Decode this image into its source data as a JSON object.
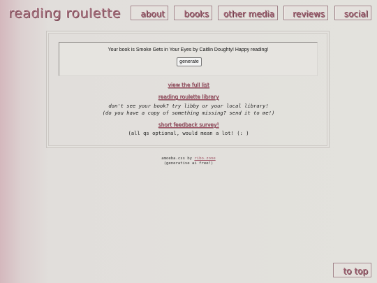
{
  "header": {
    "title": "reading roulette"
  },
  "nav": {
    "about": "about",
    "books": "books",
    "other_media": "other media",
    "reviews": "reviews",
    "social": "social"
  },
  "generator": {
    "result": "Your book is Smoke Gets in Your Eyes by Caitlin Doughty! Happy reading!",
    "button_label": "generate"
  },
  "links": {
    "full_list": "view the full list",
    "library": "reading roulette library",
    "feedback": "short feedback survey!"
  },
  "text": {
    "library_line1": "don't see your book? try libby or your local library!",
    "library_line2": "(do you have a copy of something missing? send it to me!)",
    "feedback_note": "(all qs optional, would mean a lot! (: )"
  },
  "footer": {
    "credit_prefix": "amoeba.css by ",
    "credit_link": "ribo.zone",
    "note": "(generative ai free!)"
  },
  "to_top": "to top",
  "colors": {
    "accent": "#a05f70",
    "background": "#e3e2dd"
  }
}
